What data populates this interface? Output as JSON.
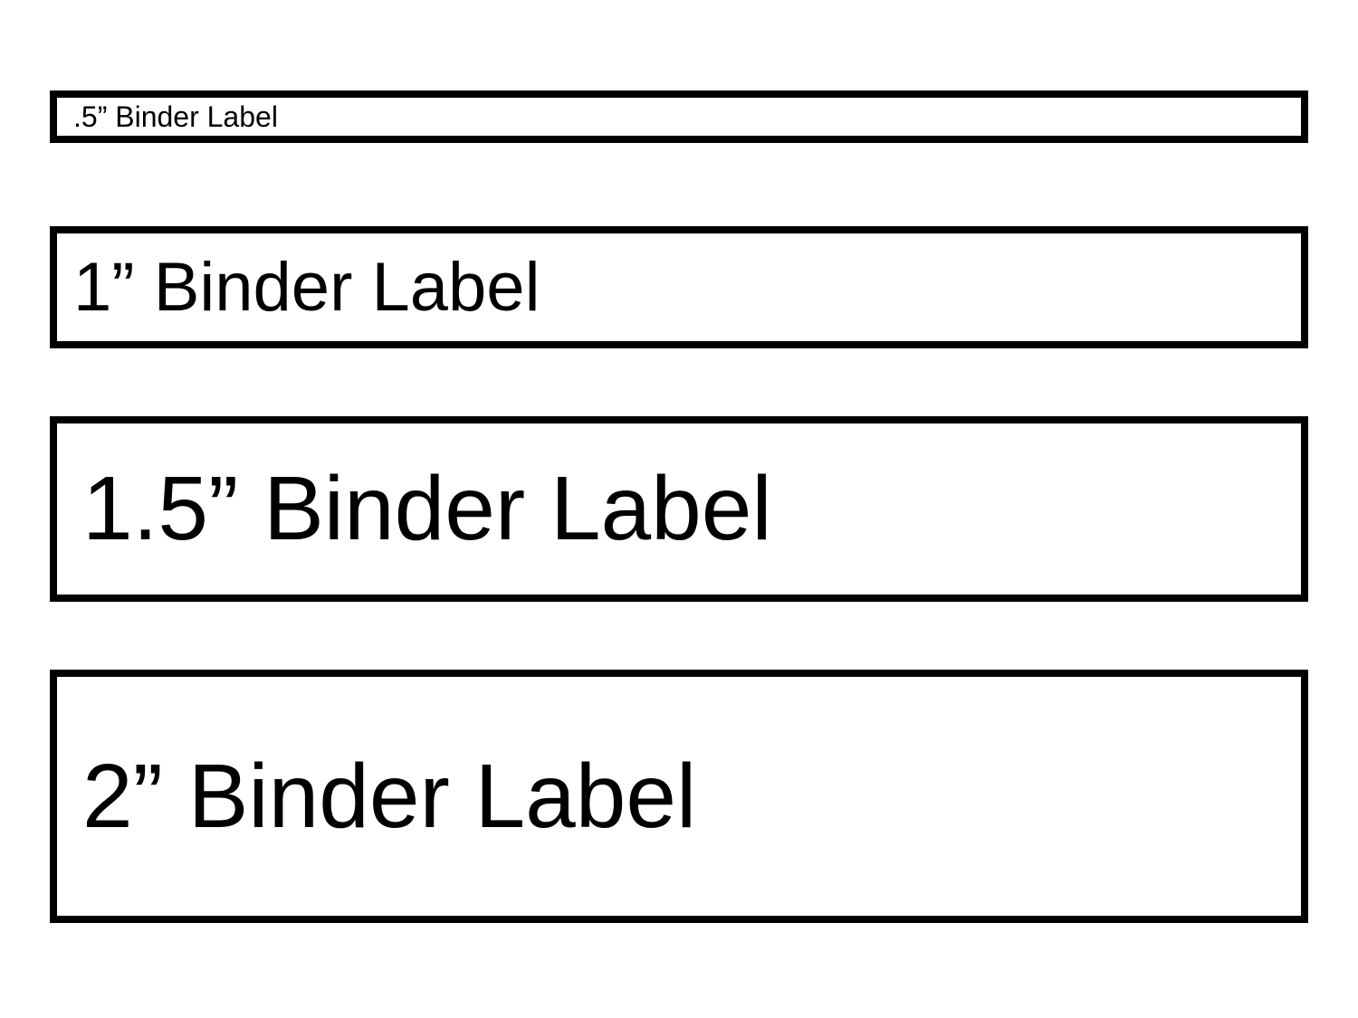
{
  "labels": [
    {
      "text": ".5” Binder Label",
      "size": "0.5"
    },
    {
      "text": "1” Binder Label",
      "size": "1"
    },
    {
      "text": "1.5” Binder Label",
      "size": "1.5"
    },
    {
      "text": "2” Binder Label",
      "size": "2"
    }
  ]
}
